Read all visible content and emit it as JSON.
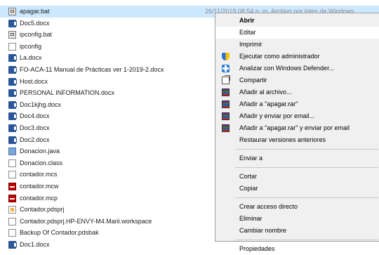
{
  "files": [
    {
      "name": "apagar.bat",
      "icon": "batch-file-icon",
      "selected": true,
      "extra": "26/11/2019 08:54 p. m.    Archivo por lotes de Windows"
    },
    {
      "name": "Doc5.docx",
      "icon": "word-document-icon"
    },
    {
      "name": "ipconfig.bat",
      "icon": "batch-file-icon"
    },
    {
      "name": "ipconfig",
      "icon": "blank-file-icon"
    },
    {
      "name": "La.docx",
      "icon": "word-document-icon"
    },
    {
      "name": "FO-ACA-11 Manual de Prácticas ver 1-2019-2.docx",
      "icon": "word-document-icon"
    },
    {
      "name": "Host.docx",
      "icon": "word-document-icon"
    },
    {
      "name": "PERSONAL INFORMATION.docx",
      "icon": "word-document-icon"
    },
    {
      "name": "Doc1kjhg.docx",
      "icon": "word-document-icon"
    },
    {
      "name": "Doc4.docx",
      "icon": "word-document-icon"
    },
    {
      "name": "Doc3.docx",
      "icon": "word-document-icon"
    },
    {
      "name": "Doc2.docx",
      "icon": "word-document-icon"
    },
    {
      "name": "Donacion.java",
      "icon": "java-file-icon"
    },
    {
      "name": "Donacion.class",
      "icon": "blank-file-icon"
    },
    {
      "name": "contador.mcs",
      "icon": "blank-file-icon"
    },
    {
      "name": "contador.mcw",
      "icon": "mplab-file-icon"
    },
    {
      "name": "contador.mcp",
      "icon": "mplab-file-icon"
    },
    {
      "name": "Contador.pdsprj",
      "icon": "proteus-file-icon"
    },
    {
      "name": "Contador.pdsprj.HP-ENVY-M4.Marii.workspace",
      "icon": "blank-file-icon"
    },
    {
      "name": "Backup Of Contador.pdsbak",
      "icon": "blank-file-icon"
    },
    {
      "name": "Doc1.docx",
      "icon": "word-document-icon"
    }
  ],
  "context_menu": {
    "items": [
      {
        "label": "Abrir",
        "bold": true
      },
      {
        "label": "Editar",
        "hover": true
      },
      {
        "label": "Imprimir"
      },
      {
        "label": "Ejecutar como administrador",
        "icon": "uac-shield-icon"
      },
      {
        "label": "Analizar con Windows Defender...",
        "icon": "windows-defender-icon"
      },
      {
        "label": "Compartir",
        "icon": "share-icon"
      },
      {
        "label": "Añadir al archivo...",
        "icon": "winrar-icon"
      },
      {
        "label": "Añadir a \"apagar.rar\"",
        "icon": "winrar-icon"
      },
      {
        "label": "Añadir y enviar por email...",
        "icon": "winrar-icon"
      },
      {
        "label": "Añadir a \"apagar.rar\" y enviar por email",
        "icon": "winrar-icon"
      },
      {
        "label": "Restaurar versiones anteriores"
      },
      {
        "separator": true
      },
      {
        "label": "Enviar a"
      },
      {
        "separator": true
      },
      {
        "label": "Cortar"
      },
      {
        "label": "Copiar"
      },
      {
        "separator": true
      },
      {
        "label": "Crear acceso directo"
      },
      {
        "label": "Eliminar"
      },
      {
        "label": "Cambiar nombre"
      },
      {
        "separator": true
      },
      {
        "label": "Propiedades"
      }
    ]
  }
}
